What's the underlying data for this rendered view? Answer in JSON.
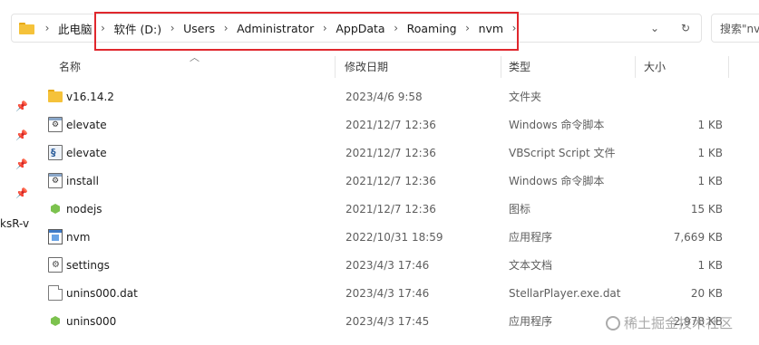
{
  "address_bar": {
    "root_label": "此电脑",
    "segments": [
      "软件 (D:)",
      "Users",
      "Administrator",
      "AppData",
      "Roaming",
      "nvm"
    ]
  },
  "search": {
    "placeholder": "搜索\"nvm\""
  },
  "sidebar": {
    "partial_text": "ksR-v"
  },
  "columns": {
    "name": "名称",
    "modified": "修改日期",
    "type": "类型",
    "size": "大小"
  },
  "files": [
    {
      "name": "v16.14.2",
      "modified": "2023/4/6 9:58",
      "type": "文件夹",
      "size": "",
      "icon": "folder-icon"
    },
    {
      "name": "elevate",
      "modified": "2021/12/7 12:36",
      "type": "Windows 命令脚本",
      "size": "1 KB",
      "icon": "cmd-script-icon"
    },
    {
      "name": "elevate",
      "modified": "2021/12/7 12:36",
      "type": "VBScript Script 文件",
      "size": "1 KB",
      "icon": "vbscript-icon"
    },
    {
      "name": "install",
      "modified": "2021/12/7 12:36",
      "type": "Windows 命令脚本",
      "size": "1 KB",
      "icon": "cmd-script-icon"
    },
    {
      "name": "nodejs",
      "modified": "2021/12/7 12:36",
      "type": "图标",
      "size": "15 KB",
      "icon": "nodejs-icon"
    },
    {
      "name": "nvm",
      "modified": "2022/10/31 18:59",
      "type": "应用程序",
      "size": "7,669 KB",
      "icon": "application-icon"
    },
    {
      "name": "settings",
      "modified": "2023/4/3 17:46",
      "type": "文本文档",
      "size": "1 KB",
      "icon": "settings-file-icon"
    },
    {
      "name": "unins000.dat",
      "modified": "2023/4/3 17:46",
      "type": "StellarPlayer.exe.dat",
      "size": "20 KB",
      "icon": "blank-document-icon"
    },
    {
      "name": "unins000",
      "modified": "2023/4/3 17:45",
      "type": "应用程序",
      "size": "2,978 KB",
      "icon": "nodejs-icon"
    }
  ],
  "watermark": "稀土掘金技术社区",
  "colors": {
    "highlight_border": "#e0272d",
    "folder": "#f5c23a"
  }
}
